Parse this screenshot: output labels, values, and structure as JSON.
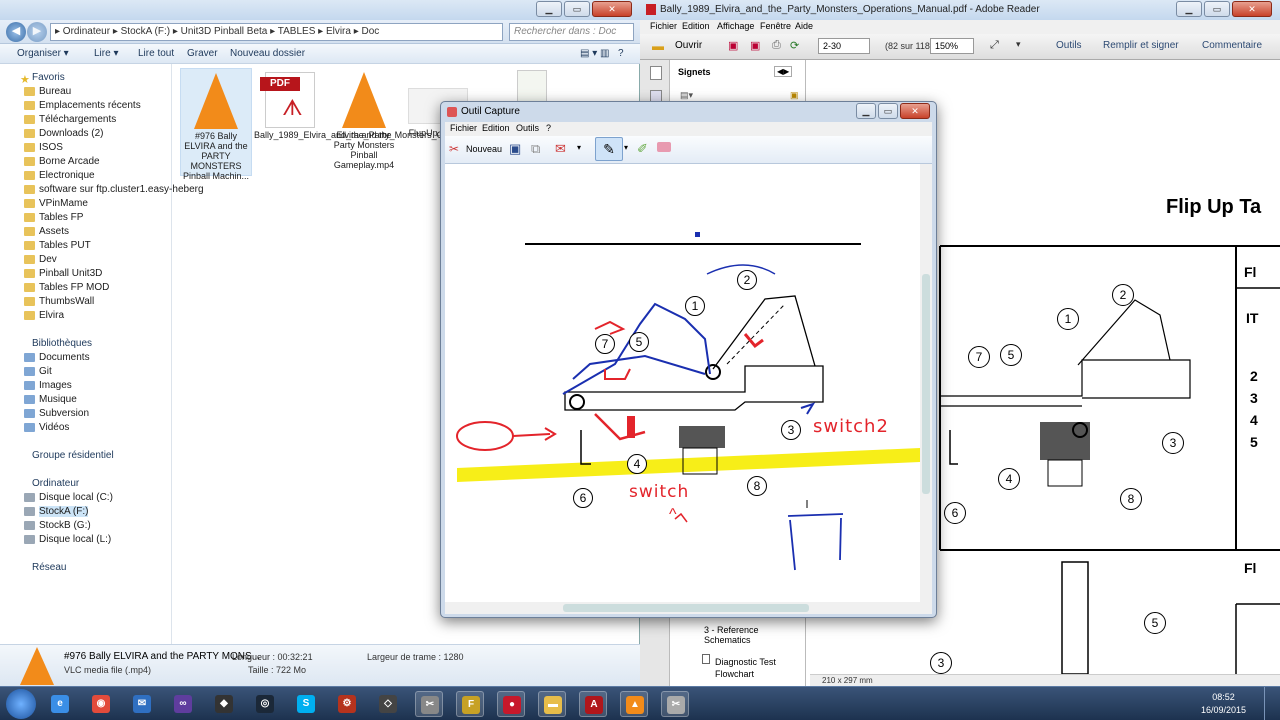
{
  "explorer": {
    "breadcrumb": "▸ Ordinateur ▸ StockA (F:) ▸ Unit3D Pinball Beta ▸ TABLES ▸ Elvira ▸ Doc",
    "search_placeholder": "Rechercher dans : Doc",
    "toolbar": [
      "Organiser ▾",
      "Lire ▾",
      "Lire tout",
      "Graver",
      "Nouveau dossier"
    ],
    "favorites_header": "Favoris",
    "favorites": [
      "Bureau",
      "Emplacements récents",
      "Téléchargements",
      "Downloads (2)",
      "ISOS",
      "Borne Arcade",
      "Electronique",
      "software sur ftp.cluster1.easy-heberg",
      "VPinMame",
      "Tables FP",
      "Assets",
      "Tables PUT",
      "Dev",
      "Pinball Unit3D",
      "Tables FP MOD",
      "ThumbsWall",
      "Elvira"
    ],
    "libraries_header": "Bibliothèques",
    "libraries": [
      "Documents",
      "Git",
      "Images",
      "Musique",
      "Subversion",
      "Vidéos"
    ],
    "homegroup": "Groupe résidentiel",
    "computer_header": "Ordinateur",
    "drives": [
      "Disque local (C:)",
      "StockA (F:)",
      "StockB (G:)",
      "Disque local (L:)"
    ],
    "network": "Réseau",
    "files": [
      {
        "name": "#976 Bally ELVIRA and the PARTY MONSTERS Pinball Machin...",
        "icon": "vlc-icon"
      },
      {
        "name": "Bally_1989_Elvira_and_the_Party_Monsters_Operations_Manual.pdf",
        "icon": "pdf-icon"
      },
      {
        "name": "Elvira and the Party Monsters Pinball Gameplay.mp4",
        "icon": "vlc-icon"
      },
      {
        "name": "FlupUp...m.P...",
        "icon": "image-icon"
      }
    ],
    "details": {
      "title": "#976 Bally ELVIRA and the PARTY MONS...",
      "type": "VLC media file (.mp4)",
      "duration_label": "Longueur : 00:32:21",
      "size_label": "Taille : 722 Mo",
      "frame_width_label": "Largeur de trame : 1280"
    }
  },
  "adobe": {
    "title": "Bally_1989_Elvira_and_the_Party_Monsters_Operations_Manual.pdf - Adobe Reader",
    "menu": [
      "Fichier",
      "Edition",
      "Affichage",
      "Fenêtre",
      "Aide"
    ],
    "open_label": "Ouvrir",
    "page_value": "2-30",
    "page_count": "(82 sur 118)",
    "zoom_value": "150%",
    "tools": [
      "Outils",
      "Remplir et signer",
      "Commentaire"
    ],
    "bookmarks_header": "Signets",
    "bookmarks": [
      "3 - Reference Schematics",
      "Diagnostic Test Flowchart"
    ],
    "doc_heading": "Flip Up Ta",
    "page_size": "210 x 297 mm",
    "callouts": [
      "1",
      "2",
      "3",
      "4",
      "5",
      "6",
      "7",
      "8"
    ],
    "page_letters": [
      "Fl",
      "IT",
      "2",
      "3",
      "4",
      "5"
    ]
  },
  "snip": {
    "title": "Outil Capture",
    "menu": [
      "Fichier",
      "Edition",
      "Outils",
      "?"
    ],
    "new_label": "Nouveau",
    "annotation_switch2": "switch2",
    "annotation_switch": "switch",
    "annotation_caret": "^",
    "callouts": [
      "1",
      "2",
      "3",
      "4",
      "5",
      "6",
      "7",
      "8"
    ]
  },
  "taskbar": {
    "apps": [
      "start",
      "ie",
      "chrome",
      "thunderbird",
      "vs",
      "unity",
      "steam",
      "skype",
      "pinball",
      "unity3d",
      "snip",
      "fpm",
      "pdfred",
      "folder",
      "acrobat",
      "vlc",
      "snip2"
    ],
    "time": "08:52",
    "date": "16/09/2015"
  },
  "colors": {
    "accent": "#3b6ea8",
    "annotation_red": "#e3242b",
    "annotation_blue": "#1a2fb0",
    "highlight_yellow": "#f7ee18"
  }
}
